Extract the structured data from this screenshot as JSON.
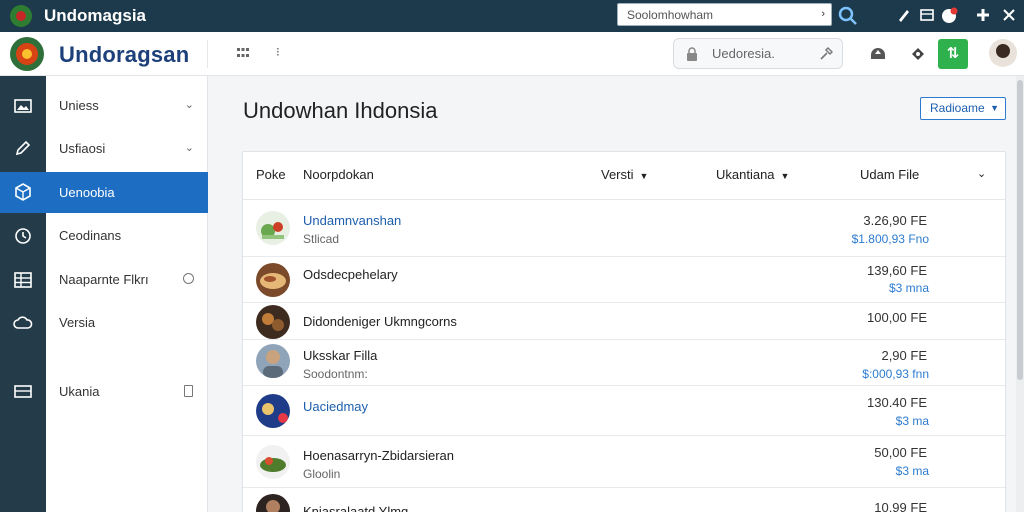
{
  "topbar": {
    "app_name": "Undomagsia",
    "search_value": "Soolomhowham"
  },
  "header": {
    "brand": "Undoragsan",
    "search_placeholder": "Uedoresia."
  },
  "sidebar": {
    "items": [
      {
        "label": "Uniess",
        "icon": "gallery-icon",
        "has_chevron": true
      },
      {
        "label": "Usfiaosi",
        "icon": "pen-icon",
        "has_chevron": true
      },
      {
        "label": "Uenoobia",
        "icon": "cube-icon",
        "active": true
      },
      {
        "label": "Ceodinans",
        "icon": "clock-icon"
      },
      {
        "label": "Naaparnte Flkrı",
        "icon": "table-icon",
        "has_circle": true
      },
      {
        "label": "Versia",
        "icon": "cloud-icon"
      },
      {
        "label": "Ukania",
        "icon": "card-icon",
        "has_doc": true
      }
    ]
  },
  "main": {
    "title": "Undowhan Ihdonsia",
    "filter_label": "Radioame",
    "table": {
      "columns": [
        "Poke",
        "Noorpdokan",
        "Versti",
        "Ukantiana",
        "Udam File"
      ],
      "rows": [
        {
          "name": "Undamnvanshan",
          "sub": "Stlicad",
          "size": "3.26,90 FE",
          "price": "$1.800,93 Fno",
          "link": true
        },
        {
          "name": "Odsdecpehelary",
          "sub": "",
          "size": "139,60 FE",
          "price": "$3 mna",
          "link": false
        },
        {
          "name": "Didondeniger Ukmngcorns",
          "sub": "",
          "size": "100,00 FE",
          "price": "",
          "link": false
        },
        {
          "name": "Uksskar Filla",
          "sub": "Soodontnm:",
          "size": "2,90 FE",
          "price": "$:000,93 fnn",
          "link": false
        },
        {
          "name": "Uaciedmay",
          "sub": "",
          "size": "130.40 FE",
          "price": "$3 ma",
          "link": true
        },
        {
          "name": "Hoenasarryn-Zbidarsieran",
          "sub": "Gloolin",
          "size": "50,00 FE",
          "price": "$3 ma",
          "link": false
        },
        {
          "name": "Knjasralaatd Ylmq",
          "sub": "",
          "size": "10,99 FE",
          "price": "",
          "link": false
        }
      ]
    }
  },
  "colors": {
    "topbar": "#1c3a4b",
    "rail": "#243b4a",
    "accent": "#1d6ec2",
    "green": "#2fb24d"
  }
}
